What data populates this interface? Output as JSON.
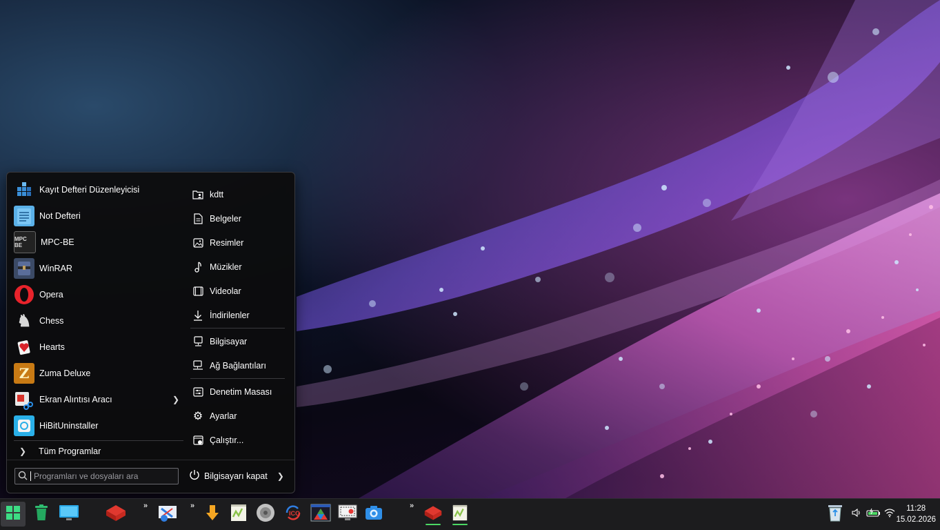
{
  "start_menu": {
    "programs": [
      {
        "label": "Kayıt Defteri Düzenleyicisi",
        "icon": "registry-editor-icon"
      },
      {
        "label": "Not Defteri",
        "icon": "notepad-icon"
      },
      {
        "label": "MPC-BE",
        "icon": "mpc-be-icon",
        "icon_text": "MPC BE"
      },
      {
        "label": "WinRAR",
        "icon": "winrar-icon"
      },
      {
        "label": "Opera",
        "icon": "opera-icon"
      },
      {
        "label": "Chess",
        "icon": "chess-icon"
      },
      {
        "label": "Hearts",
        "icon": "hearts-icon"
      },
      {
        "label": "Zuma Deluxe",
        "icon": "zuma-icon"
      },
      {
        "label": "Ekran Alıntısı Aracı",
        "icon": "snipping-tool-icon",
        "has_submenu": true
      },
      {
        "label": "HiBitUninstaller",
        "icon": "hibit-uninstaller-icon"
      }
    ],
    "all_programs_label": "Tüm Programlar",
    "search_placeholder": "Programları ve dosyaları ara",
    "places": [
      {
        "label": "kdtt",
        "icon": "user-folder-icon"
      },
      {
        "label": "Belgeler",
        "icon": "document-icon"
      },
      {
        "label": "Resimler",
        "icon": "picture-icon"
      },
      {
        "label": "Müzikler",
        "icon": "music-note-icon"
      },
      {
        "label": "Videolar",
        "icon": "film-icon"
      },
      {
        "label": "İndirilenler",
        "icon": "download-arrow-icon"
      },
      {
        "label": "Bilgisayar",
        "icon": "computer-icon"
      },
      {
        "label": "Ağ Bağlantıları",
        "icon": "network-icon"
      },
      {
        "label": "Denetim Masası",
        "icon": "control-panel-icon"
      },
      {
        "label": "Ayarlar",
        "icon": "gear-icon"
      },
      {
        "label": "Çalıştır...",
        "icon": "run-icon"
      }
    ],
    "shutdown_label": "Bilgisayarı kapat"
  },
  "taskbar": {
    "apps": [
      {
        "name": "start-button",
        "icon": "windows-logo-icon",
        "color": "#3ddc84"
      },
      {
        "name": "recycle-bin",
        "icon": "trash-icon",
        "color": "#2fbf71"
      },
      {
        "name": "desktop",
        "icon": "monitor-icon",
        "color": "#29a8e8"
      },
      {
        "name": "app-red",
        "icon": "red-cube-icon",
        "color": "#e0382f"
      },
      {
        "name": "control-panel",
        "icon": "control-panel-icon",
        "color": "#2f7de1"
      },
      {
        "name": "downloader",
        "icon": "download-arrow-icon",
        "color": "#f5a623"
      },
      {
        "name": "notepad-plus",
        "icon": "notepad-plus-icon",
        "color": "#8bc34a"
      },
      {
        "name": "audio",
        "icon": "speaker-icon",
        "color": "#c0c0c0"
      },
      {
        "name": "ico-convert",
        "icon": "ico-convert-icon",
        "color": "#e53935"
      },
      {
        "name": "color-app",
        "icon": "rgb-triangle-icon",
        "color": "#ffffff"
      },
      {
        "name": "screen-recorder",
        "icon": "screen-recorder-icon",
        "color": "#e53935"
      },
      {
        "name": "camera",
        "icon": "camera-icon",
        "color": "#2f8fe8"
      },
      {
        "name": "app-red-running",
        "icon": "red-cube-icon",
        "color": "#e0382f",
        "running": true
      },
      {
        "name": "notepad-plus-running",
        "icon": "notepad-plus-icon",
        "color": "#8bc34a",
        "running": true
      }
    ],
    "overflow_chevron": "»",
    "tray": {
      "recycle": "recycle-bin-icon",
      "volume": "volume-icon",
      "battery": "battery-icon",
      "wifi": "wifi-icon"
    },
    "clock": {
      "time": "11:28",
      "date": "15.02.2026"
    }
  }
}
